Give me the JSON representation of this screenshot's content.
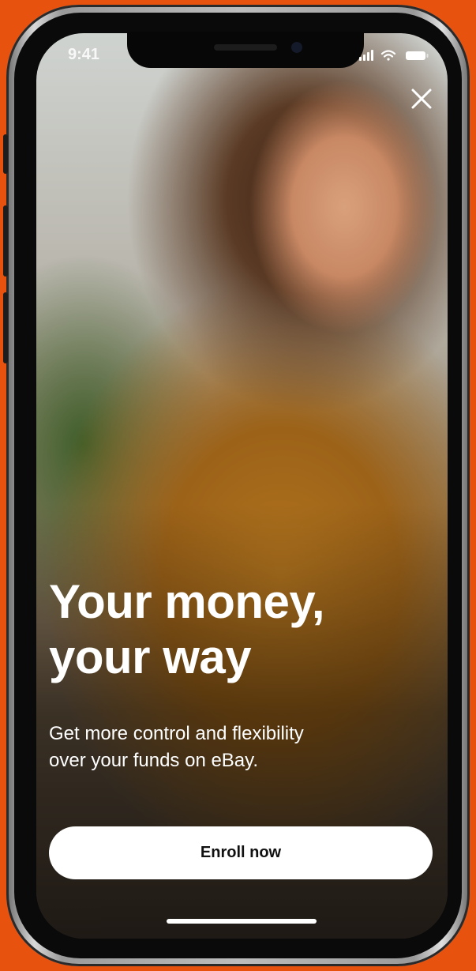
{
  "status_bar": {
    "time": "9:41",
    "icons": [
      "signal-icon",
      "wifi-icon",
      "battery-icon"
    ]
  },
  "close_button": {
    "icon": "close-icon"
  },
  "promo": {
    "headline_line1": "Your money,",
    "headline_line2": "your way",
    "subtext_line1": "Get more control and flexibility",
    "subtext_line2": "over your funds on eBay."
  },
  "cta": {
    "enroll_label": "Enroll now"
  },
  "colors": {
    "background": "#e8520f",
    "button_bg": "#ffffff",
    "button_text": "#111111",
    "headline_text": "#ffffff"
  }
}
